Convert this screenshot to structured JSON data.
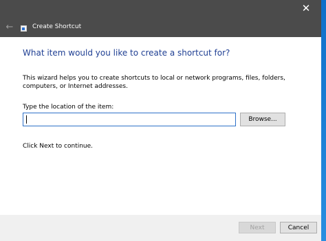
{
  "window": {
    "title": "Create Shortcut",
    "close_glyph": "✕",
    "back_glyph": "←"
  },
  "content": {
    "heading": "What item would you like to create a shortcut for?",
    "description": "This wizard helps you to create shortcuts to local or network programs, files, folders, computers, or Internet addresses.",
    "location_label": "Type the location of the item:",
    "location_value": "",
    "browse_label": "Browse...",
    "next_hint": "Click Next to continue."
  },
  "footer": {
    "next_label": "Next",
    "cancel_label": "Cancel"
  },
  "icons": {
    "close": "close-icon",
    "back": "back-arrow-icon",
    "app": "shortcut-app-icon"
  },
  "colors": {
    "titlebar": "#4b4b4b",
    "heading": "#1f3f93",
    "input_border": "#2c70c8",
    "desktop": "#1b7fd4"
  }
}
